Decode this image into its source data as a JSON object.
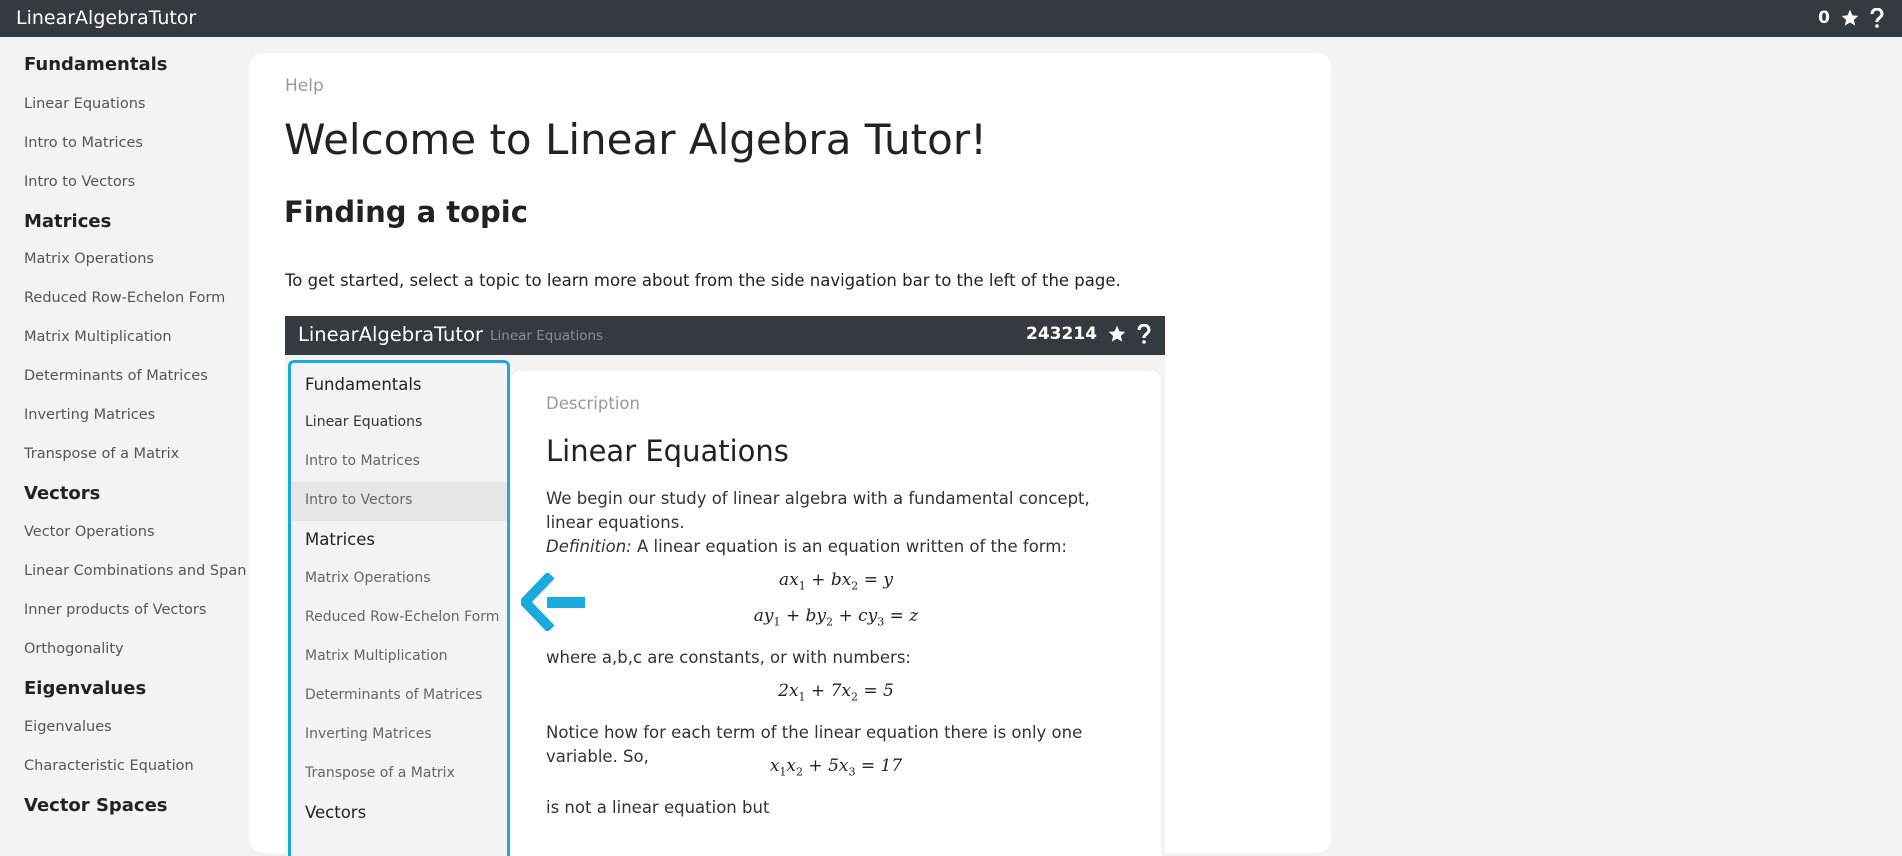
{
  "app": {
    "title": "LinearAlgebraTutor",
    "score": "0",
    "star_icon": "star-icon",
    "help_icon": "question-icon"
  },
  "sidebar": {
    "sections": [
      {
        "title": "Fundamentals",
        "items": [
          "Linear Equations",
          "Intro to Matrices",
          "Intro to Vectors"
        ]
      },
      {
        "title": "Matrices",
        "items": [
          "Matrix Operations",
          "Reduced Row-Echelon Form",
          "Matrix Multiplication",
          "Determinants of Matrices",
          "Inverting Matrices",
          "Transpose of a Matrix"
        ]
      },
      {
        "title": "Vectors",
        "items": [
          "Vector Operations",
          "Linear Combinations and Span",
          "Inner products of Vectors",
          "Orthogonality"
        ]
      },
      {
        "title": "Eigenvalues",
        "items": [
          "Eigenvalues",
          "Characteristic Equation"
        ]
      },
      {
        "title": "Vector Spaces",
        "items": []
      }
    ]
  },
  "main": {
    "breadcrumb": "Help",
    "title": "Welcome to Linear Algebra Tutor!",
    "section_title": "Finding a topic",
    "intro": "To get started, select a topic to learn more about from the side navigation bar to the left of the page."
  },
  "screenshot": {
    "brand": "LinearAlgebraTutor",
    "subtitle": "Linear Equations",
    "score": "243214",
    "sidebar": {
      "fundamentals": "Fundamentals",
      "fund_items": [
        "Linear Equations",
        "Intro to Matrices",
        "Intro to Vectors"
      ],
      "matrices": "Matrices",
      "mat_items": [
        "Matrix Operations",
        "Reduced Row-Echelon Form",
        "Matrix Multiplication",
        "Determinants of Matrices",
        "Inverting Matrices",
        "Transpose of a Matrix"
      ],
      "vectors": "Vectors"
    },
    "content": {
      "label": "Description",
      "title": "Linear Equations",
      "p1": "We begin our study of linear algebra with a fundamental concept, linear equations.",
      "def_label": "Definition:",
      "def_text": " A linear equation is an equation written of the form:",
      "p2": "where a,b,c are constants, or with numbers:",
      "p3": "Notice how for each term of the linear equation there is only one variable. So,",
      "p4": "is not a linear equation but"
    },
    "arrow_color": "#1aabdd"
  }
}
